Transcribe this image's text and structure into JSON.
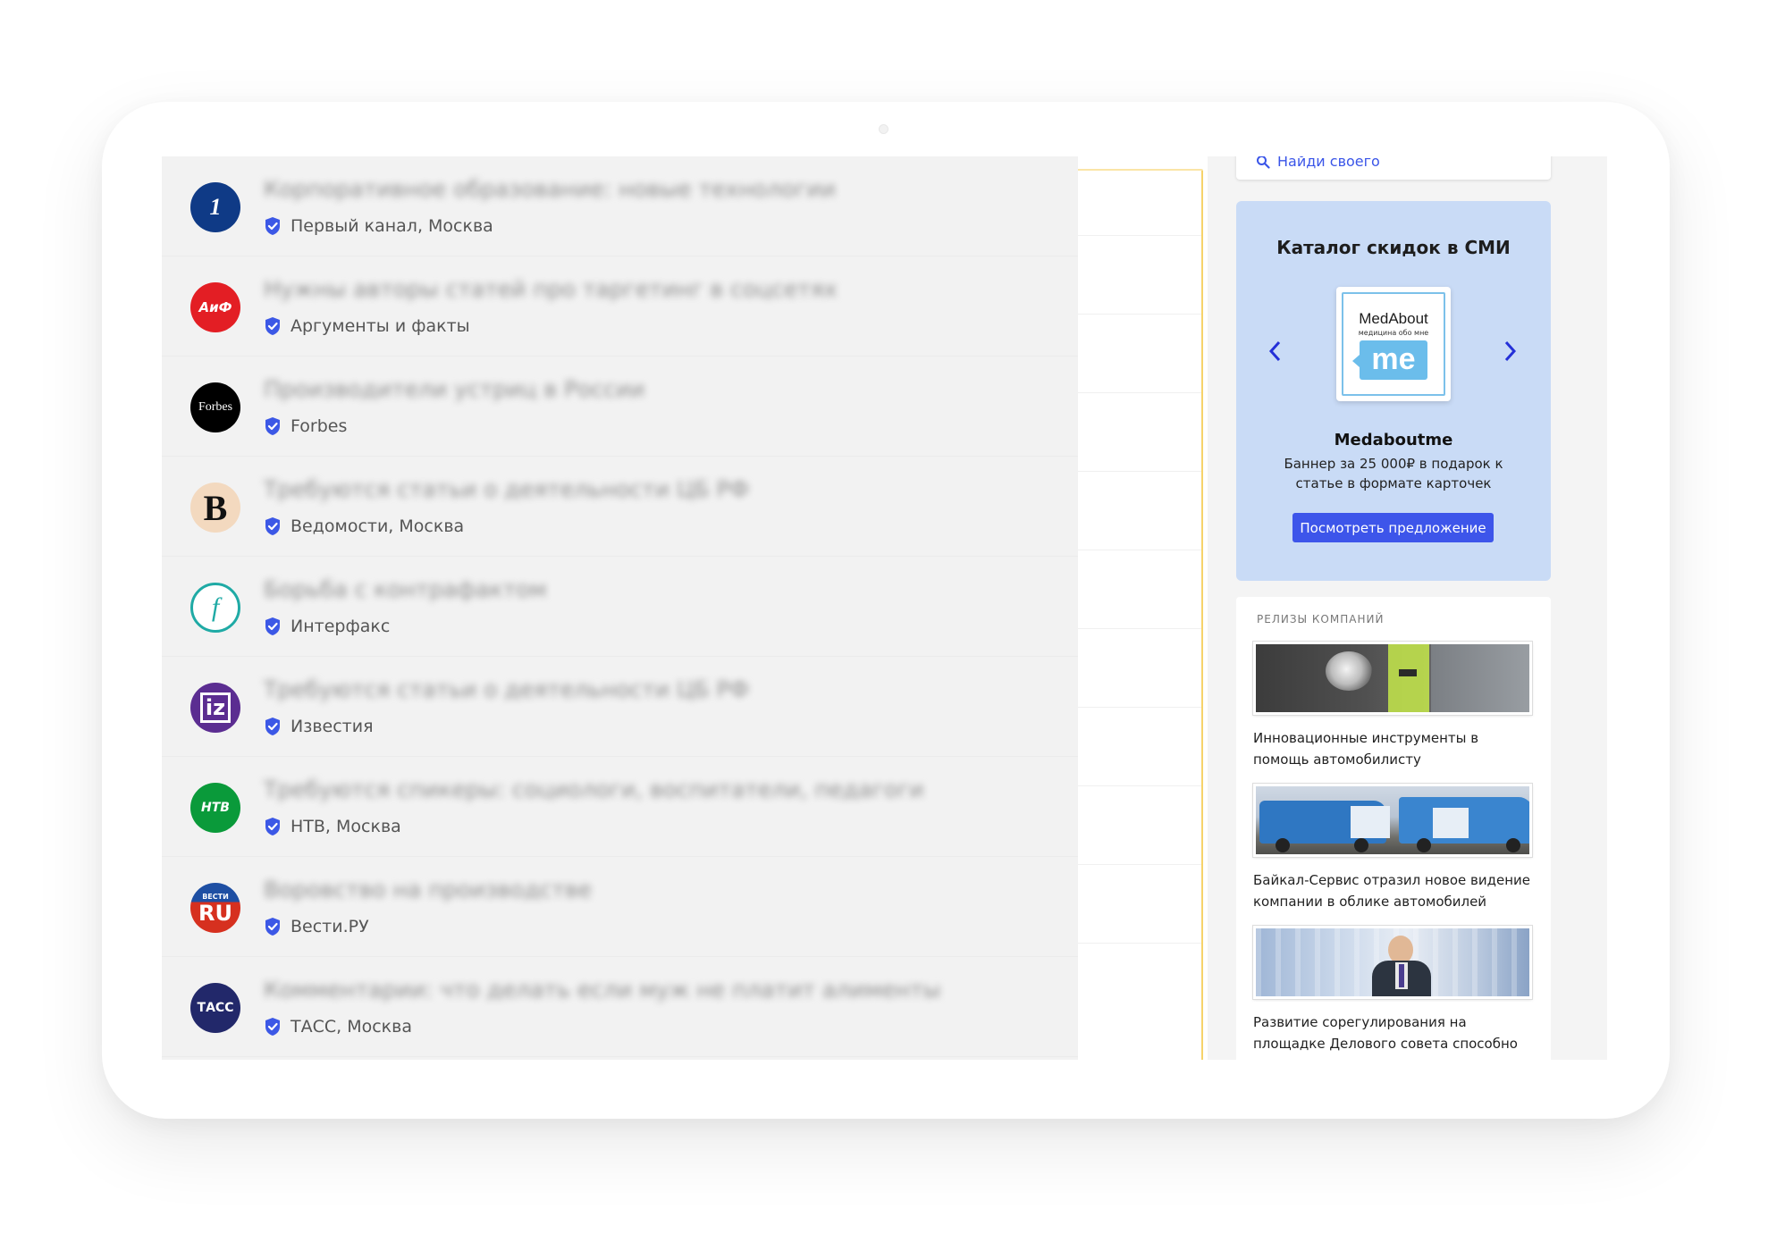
{
  "feed": {
    "items": [
      {
        "title": "Корпоративное образование: новые технологии",
        "source": "Первый канал, Москва",
        "logo": {
          "icon": "channel-one-logo-icon",
          "text": "1",
          "bg": "#0f3a86"
        }
      },
      {
        "title": "Нужны авторы статей про таргетинг в соцсетях",
        "source": "Аргументы и факты",
        "logo": {
          "icon": "aif-logo-icon",
          "text": "АиФ",
          "bg": "#e31e24"
        }
      },
      {
        "title": "Производители устриц в России",
        "source": "Forbes",
        "logo": {
          "icon": "forbes-logo-icon",
          "text": "Forbes",
          "bg": "#000000"
        }
      },
      {
        "title": "Требуются статьи о деятельности ЦБ РФ",
        "source": "Ведомости, Москва",
        "logo": {
          "icon": "vedomosti-logo-icon",
          "text": "B",
          "bg": "#f3d9bf"
        }
      },
      {
        "title": "Борьба с контрафактом",
        "source": "Интерфакс",
        "logo": {
          "icon": "interfax-logo-icon",
          "text": "f",
          "bg": "#ffffff"
        }
      },
      {
        "title": "Требуются статьи о деятельности ЦБ РФ",
        "source": "Известия",
        "logo": {
          "icon": "izvestia-logo-icon",
          "text": "iz",
          "bg": "#5b2d91"
        }
      },
      {
        "title": "Требуются спикеры: социологи, воспитатели, педагоги",
        "source": "НТВ, Москва",
        "logo": {
          "icon": "ntv-logo-icon",
          "text": "НТВ",
          "bg": "#0a9a3a"
        }
      },
      {
        "title": "Воровство на производстве",
        "source": "Вести.РУ",
        "logo": {
          "icon": "vesti-logo-icon",
          "text": "RU",
          "top": "ВЕСТИ",
          "bg": "#d6301f"
        }
      },
      {
        "title": "Комментарии: что делать если муж не платит алименты",
        "source": "ТАСС, Москва",
        "logo": {
          "icon": "tass-logo-icon",
          "text": "ТАСС",
          "bg": "#22286a"
        }
      }
    ]
  },
  "sidebar": {
    "search_link": "Найди своего",
    "promo": {
      "heading": "Каталог скидок в СМИ",
      "card_brand": "MedAbout",
      "card_sub": "медицина обо мне",
      "card_mark": "me",
      "name": "Medaboutme",
      "description": "Баннер за 25 000₽ в подарок к статье в формате карточек",
      "button": "Посмотреть предложение",
      "accent": "#3d55ea"
    },
    "releases": {
      "label": "РЕЛИЗЫ КОМПАНИЙ",
      "items": [
        {
          "text": "Инновационные инструменты в помощь автомобилисту",
          "image": "flashlight-photo"
        },
        {
          "text": "Байкал-Сервис отразил новое видение компании в облике автомобилей",
          "image": "vans-photo"
        },
        {
          "text": "Развитие сорегулирования на площадке Делового совета способно усилить ЕАЭС",
          "image": "speaker-photo"
        }
      ]
    }
  }
}
